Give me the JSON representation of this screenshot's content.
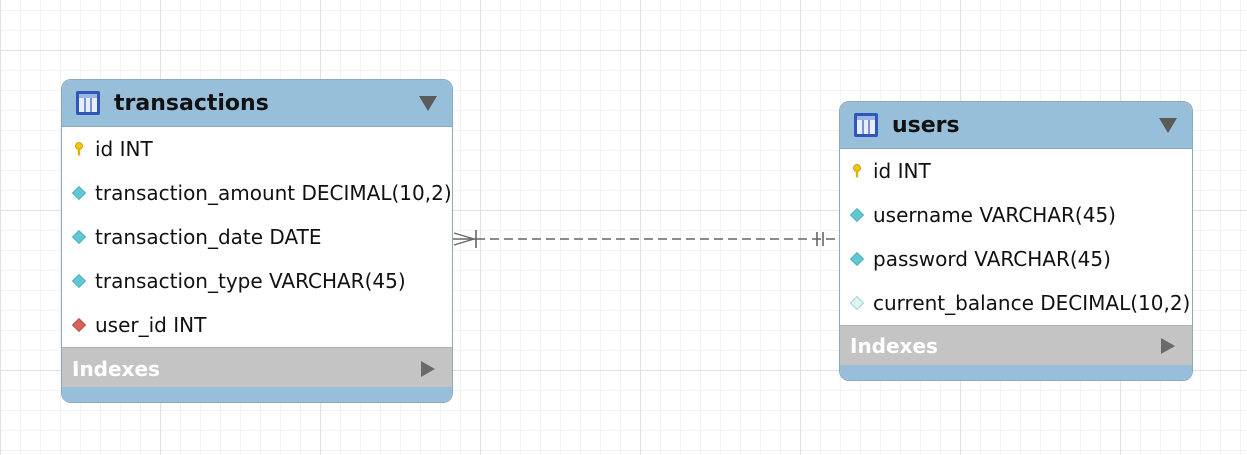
{
  "diagram": {
    "tables": [
      {
        "name": "transactions",
        "columns": [
          {
            "label": "id INT",
            "kind": "primary-key"
          },
          {
            "label": "transaction_amount DECIMAL(10,2)",
            "kind": "not-null"
          },
          {
            "label": "transaction_date DATE",
            "kind": "not-null"
          },
          {
            "label": "transaction_type VARCHAR(45)",
            "kind": "not-null"
          },
          {
            "label": "user_id INT",
            "kind": "foreign-key"
          }
        ],
        "indexes_label": "Indexes"
      },
      {
        "name": "users",
        "columns": [
          {
            "label": "id INT",
            "kind": "primary-key"
          },
          {
            "label": "username VARCHAR(45)",
            "kind": "not-null"
          },
          {
            "label": "password VARCHAR(45)",
            "kind": "not-null"
          },
          {
            "label": "current_balance DECIMAL(10,2)",
            "kind": "nullable"
          }
        ],
        "indexes_label": "Indexes"
      }
    ],
    "relationship": {
      "from": "transactions",
      "to": "users",
      "type": "many-to-one",
      "style": "dashed"
    }
  },
  "colors": {
    "header": "#97bfd9",
    "indexes_bar": "#c4c4c4",
    "primary_key": "#f2c600",
    "not_null": "#5fc8d2",
    "foreign_key": "#d6625a",
    "nullable": "#dff3f5",
    "relationship_line": "#666666"
  }
}
